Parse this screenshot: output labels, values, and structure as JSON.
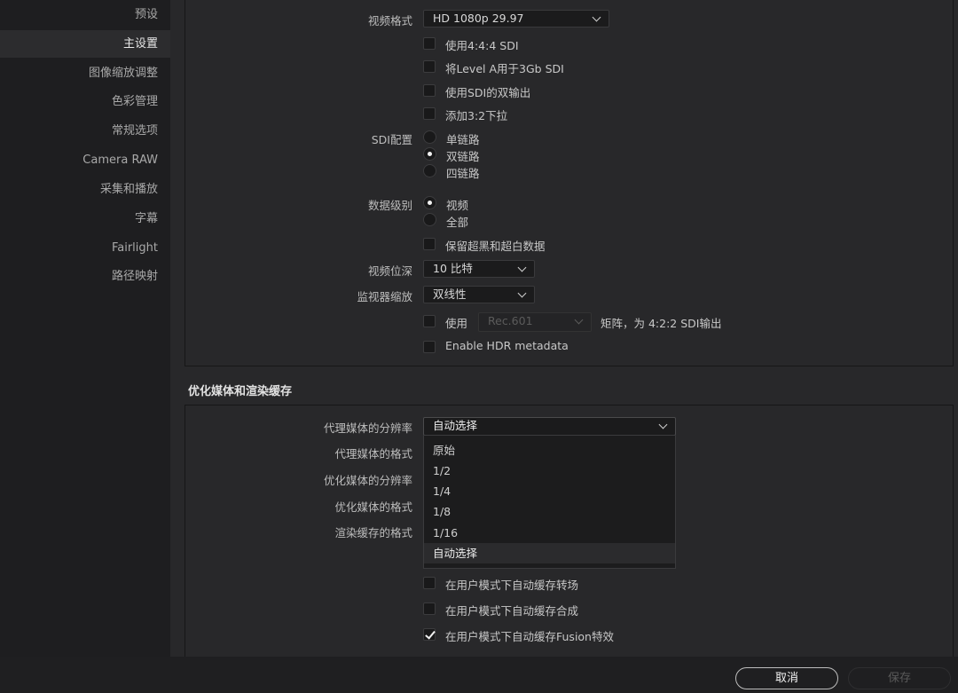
{
  "sidebar": {
    "items": [
      {
        "label": "预设"
      },
      {
        "label": "主设置"
      },
      {
        "label": "图像缩放调整"
      },
      {
        "label": "色彩管理"
      },
      {
        "label": "常规选项"
      },
      {
        "label": "Camera RAW"
      },
      {
        "label": "采集和播放"
      },
      {
        "label": "字幕"
      },
      {
        "label": "Fairlight"
      },
      {
        "label": "路径映射"
      }
    ],
    "active_index": 1
  },
  "video": {
    "format_label": "视频格式",
    "format_value": "HD 1080p 29.97",
    "use_444": "使用4:4:4 SDI",
    "level_a": "将Level A用于3Gb SDI",
    "dual_output": "使用SDI的双输出",
    "pulldown": "添加3:2下拉",
    "sdi_config_label": "SDI配置",
    "sdi_options": [
      "单链路",
      "双链路",
      "四链路"
    ],
    "sdi_selected": "双链路",
    "data_level_label": "数据级别",
    "data_level_options": [
      "视频",
      "全部"
    ],
    "data_level_selected": "视频",
    "retain_sub_super": "保留超黑和超白数据",
    "bit_depth_label": "视频位深",
    "bit_depth_value": "10 比特",
    "monitor_scaling_label": "监视器缩放",
    "monitor_scaling_value": "双线性",
    "use_label": "使用",
    "matrix_value": "Rec.601",
    "matrix_suffix": "矩阵，为 4:2:2 SDI输出",
    "hdr_metadata": "Enable HDR metadata"
  },
  "optimized": {
    "title": "优化媒体和渲染缓存",
    "proxy_resolution_label": "代理媒体的分辨率",
    "proxy_resolution_value": "自动选择",
    "proxy_format_label": "代理媒体的格式",
    "opt_resolution_label": "优化媒体的分辨率",
    "opt_format_label": "优化媒体的格式",
    "render_cache_label": "渲染缓存的格式",
    "dropdown_options": [
      "原始",
      "1/2",
      "1/4",
      "1/8",
      "1/16",
      "自动选择"
    ],
    "dropdown_selected": "自动选择",
    "cache_transitions": "在用户模式下自动缓存转场",
    "cache_composites": "在用户模式下自动缓存合成",
    "cache_fusion": "在用户模式下自动缓存Fusion特效",
    "cache_fusion_checked": true
  },
  "footer": {
    "cancel": "取消",
    "save": "保存"
  }
}
